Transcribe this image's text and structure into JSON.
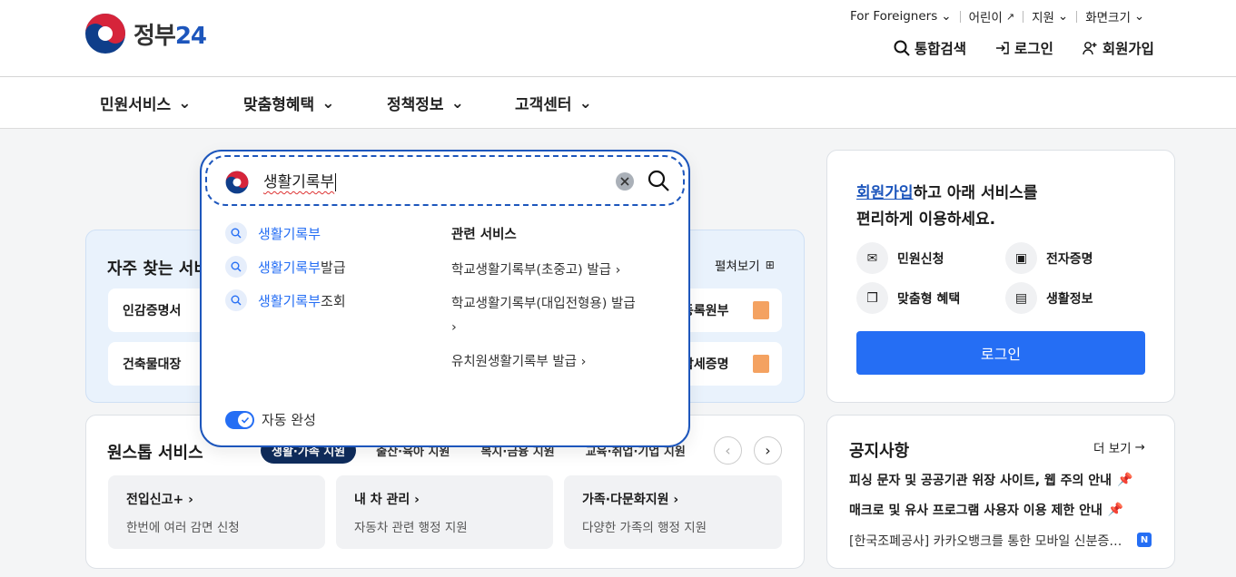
{
  "header": {
    "logo_text": "정부",
    "logo_num": "24",
    "util": [
      "For Foreigners",
      "어린이",
      "지원",
      "화면크기"
    ],
    "actions": [
      "통합검색",
      "로그인",
      "회원가입"
    ]
  },
  "gnb": [
    "민원서비스",
    "맞춤형혜택",
    "정책정보",
    "고객센터"
  ],
  "favorites": {
    "title": "자주 찾는 서비스",
    "open_all": "펼쳐보기",
    "tiles_left": [
      "인감증명서",
      "건축물대장"
    ],
    "tiles_right": [
      "등록원부",
      "납세증명"
    ]
  },
  "onestop": {
    "title": "원스톱 서비스",
    "chips": [
      "생활·가족 지원",
      "출산·육아 지원",
      "복지·금융 지원",
      "교육·취업·기업 지원"
    ],
    "tiles": [
      {
        "title": "전입신고+",
        "desc": "한번에 여러 감면 신청"
      },
      {
        "title": "내 차 관리",
        "desc": "자동차 관련 행정 지원"
      },
      {
        "title": "가족·다문화지원",
        "desc": "다양한 가족의 행정 지원"
      }
    ]
  },
  "login_card": {
    "msg_hl": "회원가입",
    "msg_rest": "하고 아래 서비스를",
    "msg_line2": "편리하게 이용하세요.",
    "services": [
      "민원신청",
      "전자증명",
      "맞춤형 혜택",
      "생활정보"
    ],
    "button": "로그인"
  },
  "notice": {
    "title": "공지사항",
    "more": "더 보기",
    "items": [
      "피싱 문자 및 공공기관 위장 사이트, 웹 주의 안내",
      "매크로 및 유사 프로그램 사용자 이용 제한 안내",
      "[한국조폐공사] 카카오뱅크를 통한 모바일 신분증…"
    ],
    "badge": "N"
  },
  "search": {
    "value": "생활기록부",
    "suggestions": [
      {
        "match": "생활기록부",
        "rest": ""
      },
      {
        "match": "생활기록부",
        "rest": "발급"
      },
      {
        "match": "생활기록부",
        "rest": "조회"
      }
    ],
    "related_title": "관련 서비스",
    "related": [
      "학교생활기록부(초중고) 발급",
      "학교생활기록부(대입전형용) 발급",
      "유치원생활기록부 발급"
    ],
    "autocomplete_label": "자동 완성",
    "autocomplete_on": true
  },
  "colors": {
    "brand": "#1d56bc",
    "primary": "#256ef4",
    "navy": "#0f2c5c"
  }
}
